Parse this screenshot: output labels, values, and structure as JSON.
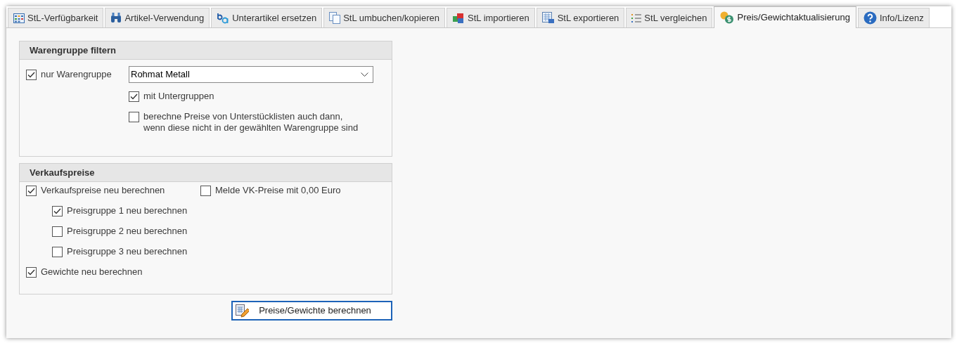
{
  "tabs": [
    {
      "label": "StL-Verfügbarkeit",
      "selected": false
    },
    {
      "label": "Artikel-Verwendung",
      "selected": false
    },
    {
      "label": "Unterartikel ersetzen",
      "selected": false
    },
    {
      "label": "StL umbuchen/kopieren",
      "selected": false
    },
    {
      "label": "StL importieren",
      "selected": false
    },
    {
      "label": "StL exportieren",
      "selected": false
    },
    {
      "label": "StL vergleichen",
      "selected": false
    },
    {
      "label": "Preis/Gewichtaktualisierung",
      "selected": true
    },
    {
      "label": "Info/Lizenz",
      "selected": false
    }
  ],
  "warengruppe_filter": {
    "title": "Warengruppe filtern",
    "only_group": {
      "label": "nur Warengruppe",
      "checked": true
    },
    "group_select": {
      "value": "Rohmat Metall"
    },
    "subgroups": {
      "label": "mit Untergruppen",
      "checked": true
    },
    "include_sub_lists": {
      "label": "berechne Preise von Unterstücklisten auch dann,\nwenn diese nicht in der gewählten Warengruppe sind",
      "checked": false
    }
  },
  "verkaufspreise": {
    "title": "Verkaufspreise",
    "recalc_sales": {
      "label": "Verkaufspreise neu berechnen",
      "checked": true
    },
    "report_zero": {
      "label": "Melde VK-Preise mit 0,00 Euro",
      "checked": false
    },
    "price_groups": [
      {
        "label": "Preisgruppe 1 neu berechnen",
        "checked": true
      },
      {
        "label": "Preisgruppe 2 neu berechnen",
        "checked": false
      },
      {
        "label": "Preisgruppe 3 neu berechnen",
        "checked": false
      }
    ],
    "recalc_weights": {
      "label": "Gewichte neu berechnen",
      "checked": true
    }
  },
  "calc_button": {
    "label": "Preise/Gewichte berechnen"
  }
}
